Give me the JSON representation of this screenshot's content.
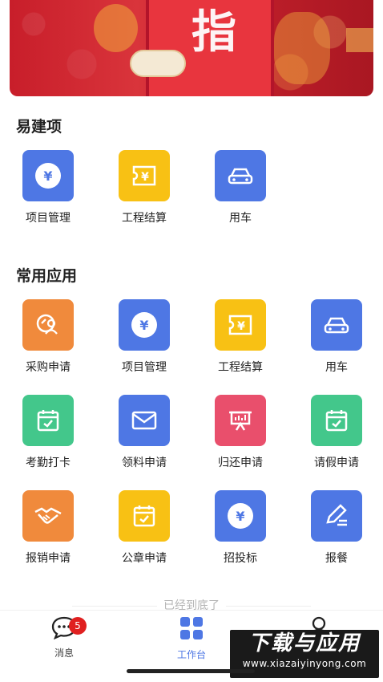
{
  "banner": {
    "glyph": "指"
  },
  "sections": {
    "yijian": {
      "title": "易建项",
      "apps": [
        {
          "label": "项目管理",
          "icon": "yen-coin-icon",
          "color": "#4e77e4"
        },
        {
          "label": "工程结算",
          "icon": "yen-ticket-icon",
          "color": "#f8c114"
        },
        {
          "label": "用车",
          "icon": "car-icon",
          "color": "#4e77e4"
        }
      ]
    },
    "common": {
      "title": "常用应用",
      "apps": [
        {
          "label": "采购申请",
          "icon": "purchase-person-icon",
          "color": "#f08a3c"
        },
        {
          "label": "项目管理",
          "icon": "yen-coin-icon",
          "color": "#4e77e4"
        },
        {
          "label": "工程结算",
          "icon": "yen-ticket-icon",
          "color": "#f8c114"
        },
        {
          "label": "用车",
          "icon": "car-icon",
          "color": "#4e77e4"
        },
        {
          "label": "考勤打卡",
          "icon": "calendar-check-icon",
          "color": "#43c78b"
        },
        {
          "label": "领料申请",
          "icon": "envelope-icon",
          "color": "#4e77e4"
        },
        {
          "label": "归还申请",
          "icon": "board-chart-icon",
          "color": "#e94f6c"
        },
        {
          "label": "请假申请",
          "icon": "calendar-check-icon",
          "color": "#43c78b"
        },
        {
          "label": "报销申请",
          "icon": "handshake-icon",
          "color": "#f08a3c"
        },
        {
          "label": "公章申请",
          "icon": "calendar-check-icon",
          "color": "#f8c114"
        },
        {
          "label": "招投标",
          "icon": "yen-coin-icon",
          "color": "#4e77e4"
        },
        {
          "label": "报餐",
          "icon": "pen-edit-icon",
          "color": "#4e77e4"
        }
      ]
    }
  },
  "end_text": "已经到底了",
  "tabbar": {
    "messages": {
      "label": "消息",
      "badge": "5"
    },
    "workbench": {
      "label": "工作台"
    }
  },
  "watermark": {
    "title": "下载与应用",
    "url": "www.xiazaiyinyong.com"
  }
}
